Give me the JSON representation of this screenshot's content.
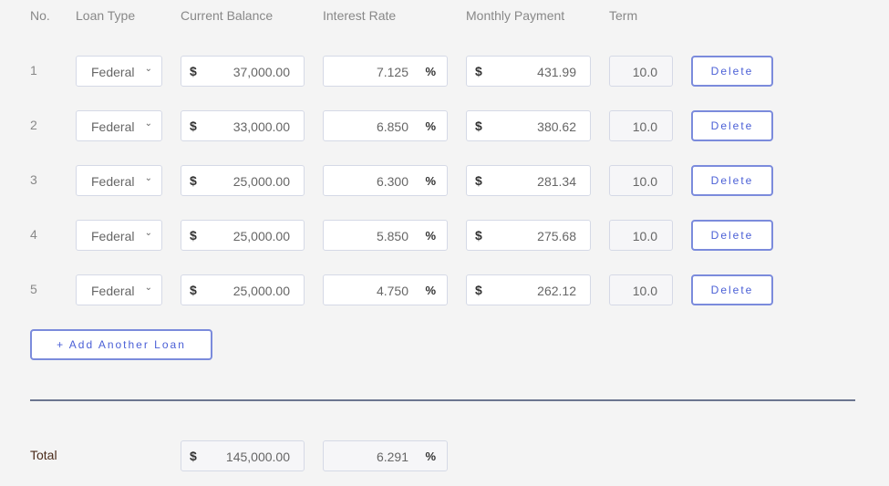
{
  "headers": {
    "no": "No.",
    "loan_type": "Loan Type",
    "balance": "Current Balance",
    "rate": "Interest Rate",
    "payment": "Monthly Payment",
    "term": "Term"
  },
  "currency": "$",
  "percent": "%",
  "delete_label": "Delete",
  "loans": [
    {
      "no": "1",
      "type": "Federal",
      "balance": "37,000.00",
      "rate": "7.125",
      "payment": "431.99",
      "term": "10.0"
    },
    {
      "no": "2",
      "type": "Federal",
      "balance": "33,000.00",
      "rate": "6.850",
      "payment": "380.62",
      "term": "10.0"
    },
    {
      "no": "3",
      "type": "Federal",
      "balance": "25,000.00",
      "rate": "6.300",
      "payment": "281.34",
      "term": "10.0"
    },
    {
      "no": "4",
      "type": "Federal",
      "balance": "25,000.00",
      "rate": "5.850",
      "payment": "275.68",
      "term": "10.0"
    },
    {
      "no": "5",
      "type": "Federal",
      "balance": "25,000.00",
      "rate": "4.750",
      "payment": "262.12",
      "term": "10.0"
    }
  ],
  "add_label": "+ Add Another Loan",
  "total": {
    "label": "Total",
    "balance": "145,000.00",
    "rate": "6.291"
  },
  "colors": {
    "accent": "#4a5fd6",
    "border_accent": "#7b8bdc",
    "divider": "#6b7590"
  }
}
